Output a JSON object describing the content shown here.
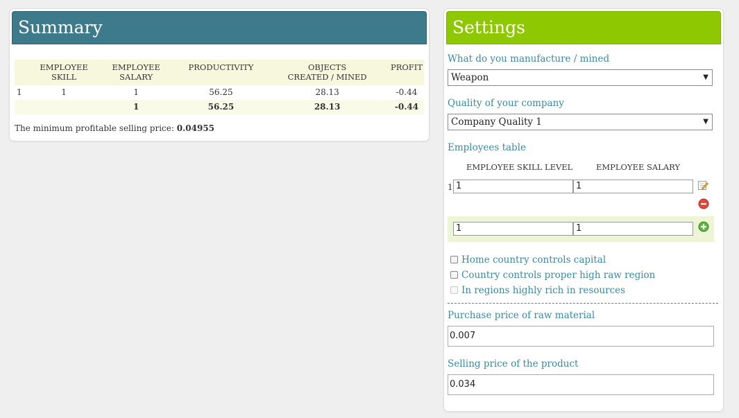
{
  "summary": {
    "title": "Summary",
    "headers": {
      "skill": [
        "EMPLOYEE",
        "SKILL"
      ],
      "salary": [
        "EMPLOYEE",
        "SALARY"
      ],
      "productivity": "PRODUCTIVITY",
      "objects": [
        "OBJECTS",
        "CREATED / MINED"
      ],
      "profit": "PROFIT"
    },
    "rows": [
      {
        "num": "1",
        "skill": "1",
        "salary": "1",
        "productivity": "56.25",
        "objects": "28.13",
        "profit": "-0.44"
      }
    ],
    "total": {
      "salary": "1",
      "productivity": "56.25",
      "objects": "28.13",
      "profit": "-0.44"
    },
    "min_price_label": "The minimum profitable selling price:",
    "min_price_value": "0.04955"
  },
  "settings": {
    "title": "Settings",
    "manufacture_label": "What do you manufacture / mined",
    "manufacture_value": "Weapon",
    "quality_label": "Quality of your company",
    "quality_value": "Company Quality 1",
    "employees_label": "Employees table",
    "col_skill": "EMPLOYEE SKILL LEVEL",
    "col_salary": "EMPLOYEE SALARY",
    "employee_rows": [
      {
        "num": "1",
        "skill": "1",
        "salary": "1"
      }
    ],
    "new_row": {
      "skill": "1",
      "salary": "1"
    },
    "checkboxes": [
      {
        "label": "Home country controls capital",
        "checked": false,
        "disabled": false
      },
      {
        "label": "Country controls proper high raw region",
        "checked": false,
        "disabled": false
      },
      {
        "label": "In regions highly rich in resources",
        "checked": false,
        "disabled": true
      }
    ],
    "raw_price_label": "Purchase price of raw material",
    "raw_price_value": "0.007",
    "sell_price_label": "Selling price of the product",
    "sell_price_value": "0.034"
  },
  "colors": {
    "summary_header": "#3d7a8c",
    "settings_header": "#8dc800",
    "label_text": "#3a8aa0",
    "table_header_bg": "#f7f7dd"
  },
  "icons": [
    "edit-icon",
    "remove-icon",
    "add-icon",
    "dropdown-arrow-icon"
  ]
}
